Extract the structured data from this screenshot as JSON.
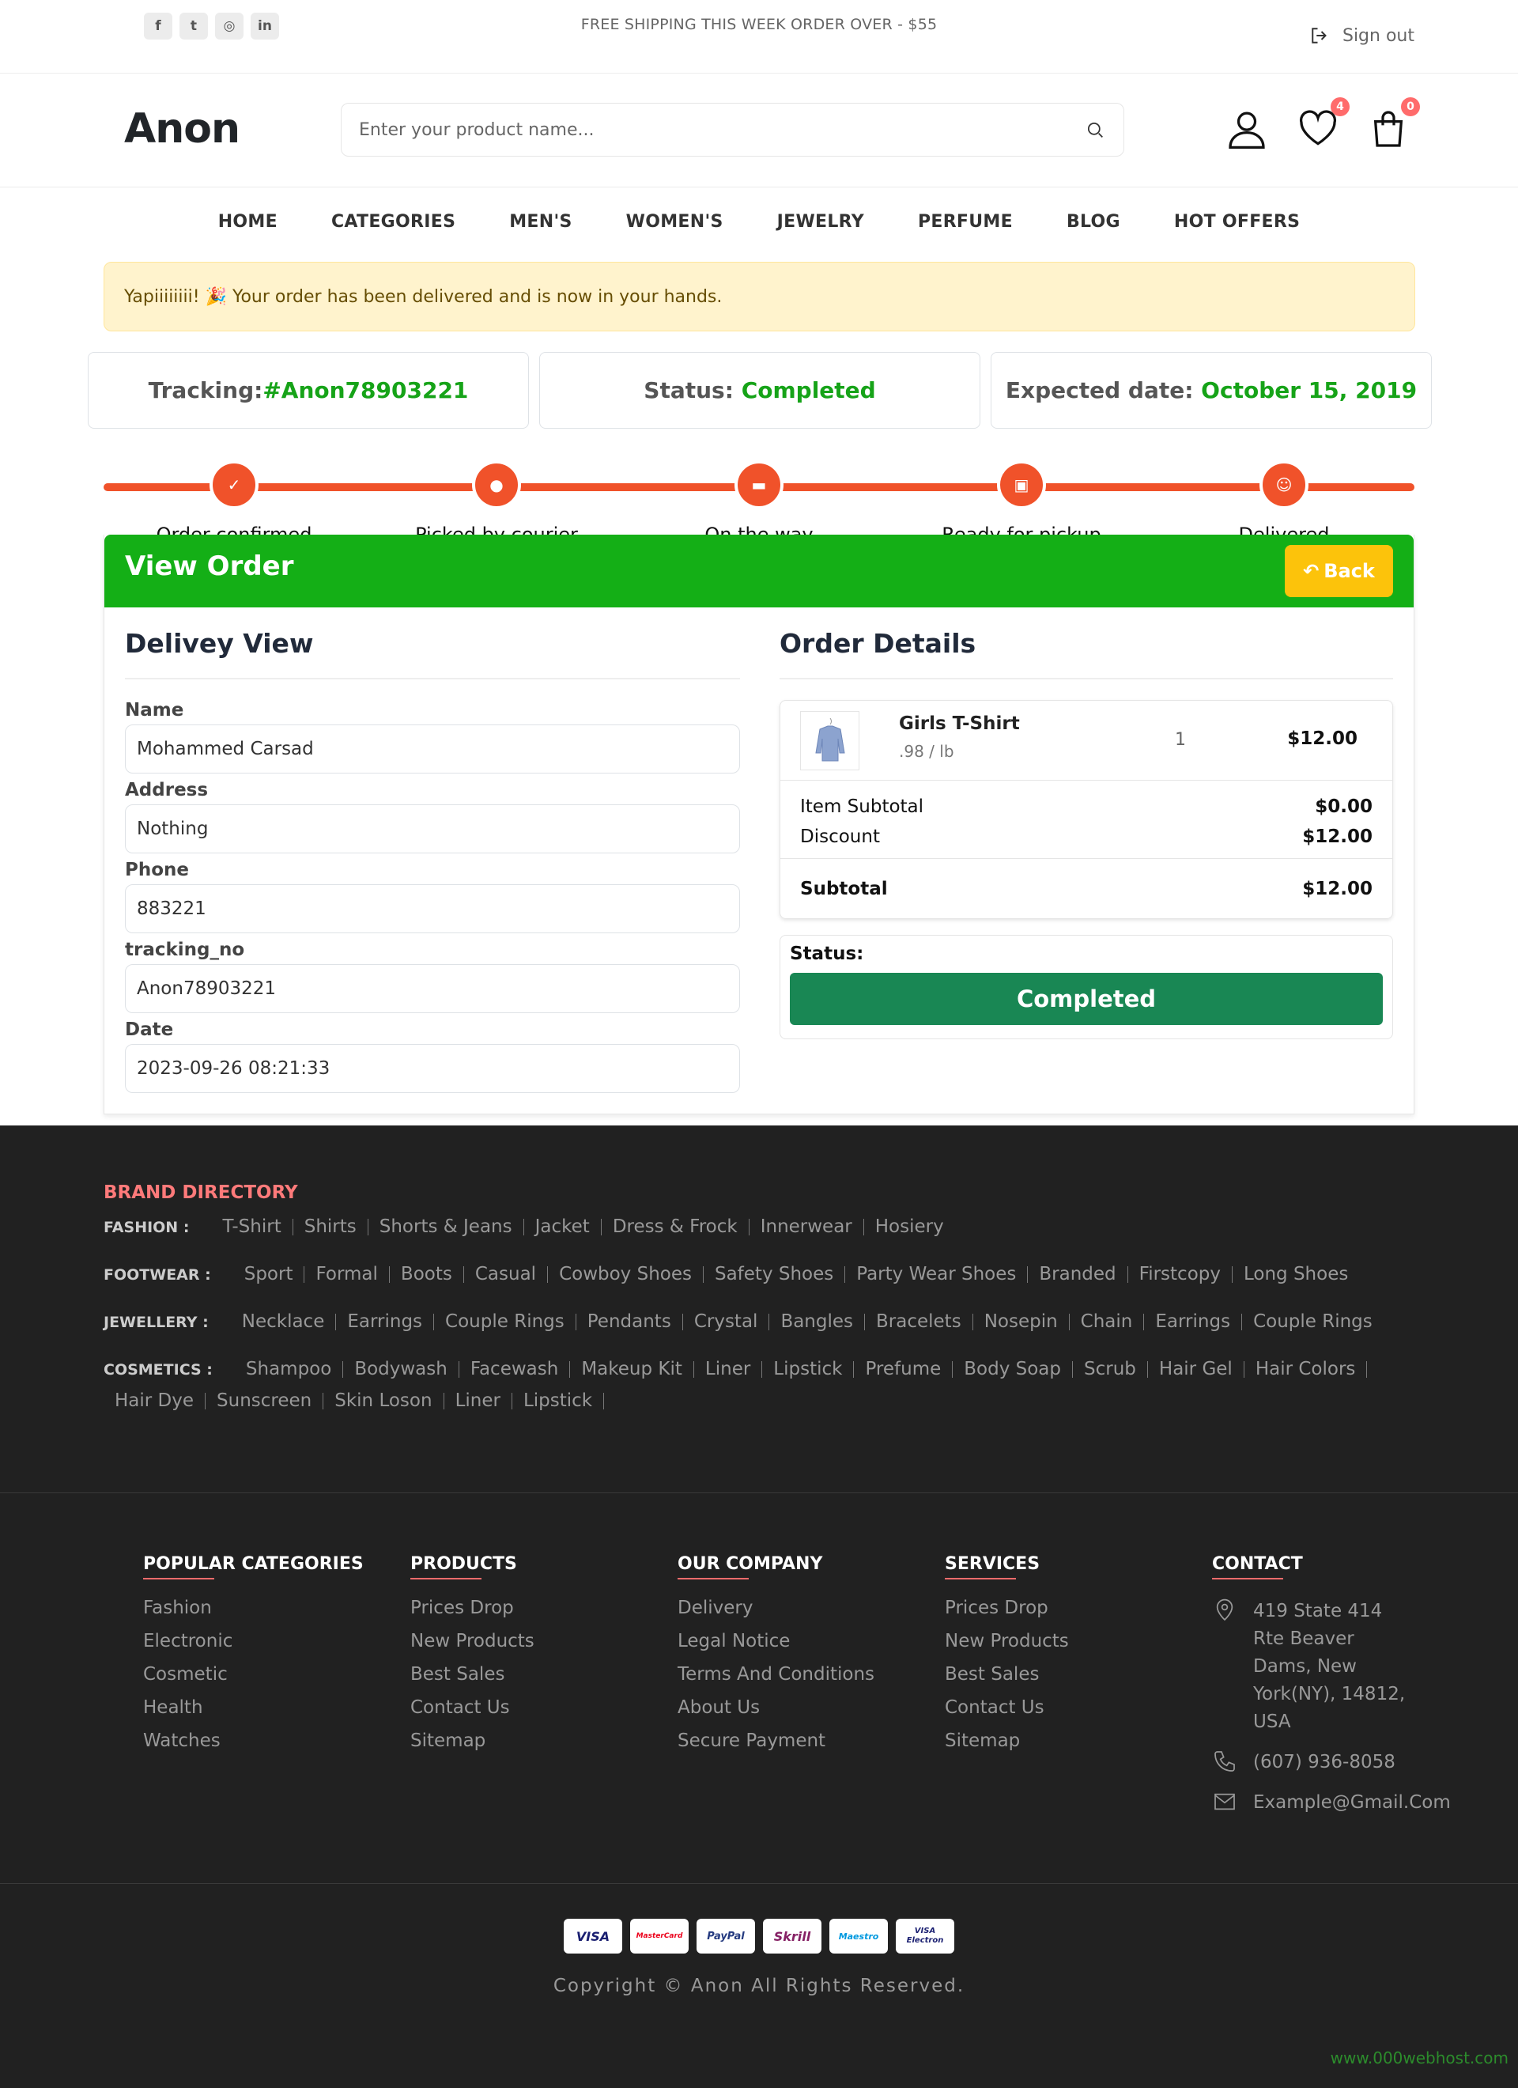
{
  "topbar": {
    "shipping": "FREE SHIPPING THIS WEEK ORDER OVER - $55",
    "signout": "Sign out"
  },
  "header": {
    "logo": "Anon",
    "search_placeholder": "Enter your product name...",
    "wishlist_count": "4",
    "cart_count": "0"
  },
  "nav": [
    "HOME",
    "CATEGORIES",
    "MEN'S",
    "WOMEN'S",
    "JEWELRY",
    "PERFUME",
    "BLOG",
    "HOT OFFERS"
  ],
  "alert": "Yapiiiiiiii! 🎉 Your order has been delivered and is now in your hands.",
  "cards": {
    "tracking_label": "Tracking:",
    "tracking_value": "#Anon78903221",
    "status_label": "Status:",
    "status_value": "Completed",
    "date_label": "Expected date:",
    "date_value": "October 15, 2019"
  },
  "steps": [
    "Order confirmed",
    "Picked by courier",
    "On the way",
    "Ready for pickup",
    "Delivered"
  ],
  "view_order": {
    "title": "View Order",
    "back": "Back",
    "delivery_title": "Delivey View",
    "fields": [
      {
        "label": "Name",
        "value": "Mohammed Carsad"
      },
      {
        "label": "Address",
        "value": "Nothing"
      },
      {
        "label": "Phone",
        "value": "883221"
      },
      {
        "label": "tracking_no",
        "value": "Anon78903221"
      },
      {
        "label": "Date",
        "value": "2023-09-26 08:21:33"
      }
    ],
    "order_title": "Order Details",
    "product": {
      "name": "Girls T-Shirt",
      "unit": ".98 / lb",
      "qty": "1",
      "price": "$12.00"
    },
    "item_subtotal_label": "Item Subtotal",
    "item_subtotal": "$0.00",
    "discount_label": "Discount",
    "discount": "$12.00",
    "subtotal_label": "Subtotal",
    "subtotal": "$12.00",
    "status_label": "Status:",
    "status_value": "Completed"
  },
  "brand_directory": {
    "title": "BRAND DIRECTORY",
    "rows": [
      {
        "cat": "FASHION :",
        "items": [
          "T-Shirt",
          "Shirts",
          "Shorts & Jeans",
          "Jacket",
          "Dress & Frock",
          "Innerwear",
          "Hosiery"
        ]
      },
      {
        "cat": "FOOTWEAR :",
        "items": [
          "Sport",
          "Formal",
          "Boots",
          "Casual",
          "Cowboy Shoes",
          "Safety Shoes",
          "Party Wear Shoes",
          "Branded",
          "Firstcopy",
          "Long Shoes"
        ]
      },
      {
        "cat": "JEWELLERY :",
        "items": [
          "Necklace",
          "Earrings",
          "Couple Rings",
          "Pendants",
          "Crystal",
          "Bangles",
          "Bracelets",
          "Nosepin",
          "Chain",
          "Earrings",
          "Couple Rings"
        ]
      },
      {
        "cat": "COSMETICS :",
        "items": [
          "Shampoo",
          "Bodywash",
          "Facewash",
          "Makeup Kit",
          "Liner",
          "Lipstick",
          "Prefume",
          "Body Soap",
          "Scrub",
          "Hair Gel",
          "Hair Colors",
          "Hair Dye",
          "Sunscreen",
          "Skin Loson",
          "Liner",
          "Lipstick"
        ]
      }
    ]
  },
  "footer_cols": [
    {
      "title": "POPULAR CATEGORIES",
      "links": [
        "Fashion",
        "Electronic",
        "Cosmetic",
        "Health",
        "Watches"
      ]
    },
    {
      "title": "PRODUCTS",
      "links": [
        "Prices Drop",
        "New Products",
        "Best Sales",
        "Contact Us",
        "Sitemap"
      ]
    },
    {
      "title": "OUR COMPANY",
      "links": [
        "Delivery",
        "Legal Notice",
        "Terms And Conditions",
        "About Us",
        "Secure Payment"
      ]
    },
    {
      "title": "SERVICES",
      "links": [
        "Prices Drop",
        "New Products",
        "Best Sales",
        "Contact Us",
        "Sitemap"
      ]
    }
  ],
  "contact": {
    "title": "CONTACT",
    "address": "419 State 414 Rte Beaver Dams, New York(NY), 14812, USA",
    "phone": "(607) 936-8058",
    "email": "Example@Gmail.Com"
  },
  "payments": [
    "VISA",
    "MasterCard",
    "PayPal",
    "Skrill",
    "Maestro",
    "VISA Electron"
  ],
  "copyright": "Copyright © Anon All Rights Reserved.",
  "watermark": "www.000webhost.com"
}
